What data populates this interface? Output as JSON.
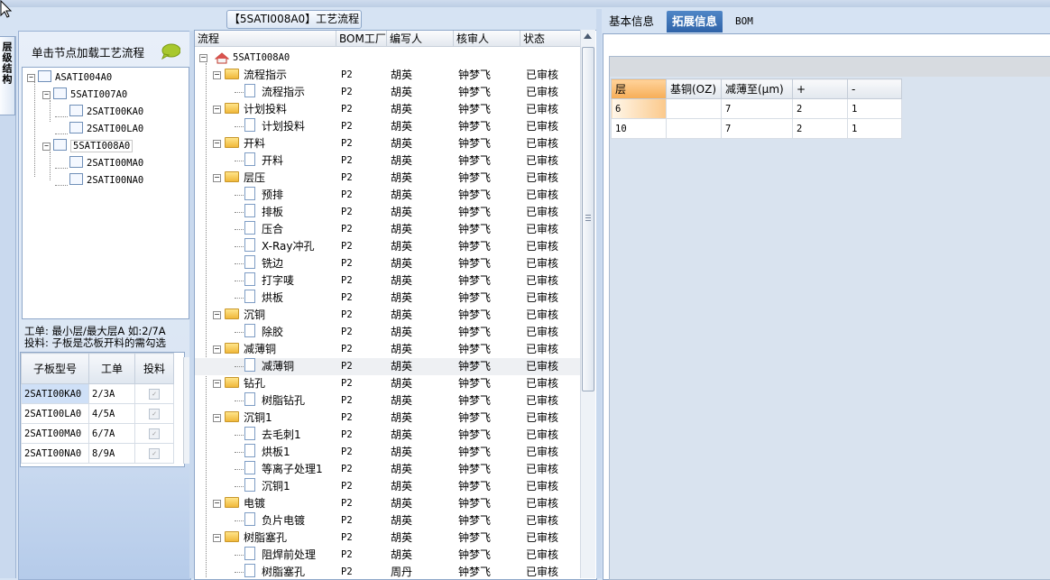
{
  "process_panel": {
    "title": "【5SATI008A0】工艺流程",
    "columns": [
      "流程",
      "BOM工厂",
      "编写人",
      "核审人",
      "状态"
    ],
    "root": "5SATI008A0",
    "rows": [
      {
        "name": "流程指示",
        "type": "folder",
        "factory": "P2",
        "writer": "胡英",
        "reviewer": "钟梦飞",
        "status": "已审核"
      },
      {
        "name": "流程指示",
        "type": "doc",
        "factory": "P2",
        "writer": "胡英",
        "reviewer": "钟梦飞",
        "status": "已审核"
      },
      {
        "name": "计划投料",
        "type": "folder",
        "factory": "P2",
        "writer": "胡英",
        "reviewer": "钟梦飞",
        "status": "已审核"
      },
      {
        "name": "计划投料",
        "type": "doc",
        "factory": "P2",
        "writer": "胡英",
        "reviewer": "钟梦飞",
        "status": "已审核"
      },
      {
        "name": "开料",
        "type": "folder",
        "factory": "P2",
        "writer": "胡英",
        "reviewer": "钟梦飞",
        "status": "已审核"
      },
      {
        "name": "开料",
        "type": "doc",
        "factory": "P2",
        "writer": "胡英",
        "reviewer": "钟梦飞",
        "status": "已审核"
      },
      {
        "name": "层压",
        "type": "folder",
        "factory": "P2",
        "writer": "胡英",
        "reviewer": "钟梦飞",
        "status": "已审核"
      },
      {
        "name": "预排",
        "type": "doc",
        "factory": "P2",
        "writer": "胡英",
        "reviewer": "钟梦飞",
        "status": "已审核"
      },
      {
        "name": "排板",
        "type": "doc",
        "factory": "P2",
        "writer": "胡英",
        "reviewer": "钟梦飞",
        "status": "已审核"
      },
      {
        "name": "压合",
        "type": "doc",
        "factory": "P2",
        "writer": "胡英",
        "reviewer": "钟梦飞",
        "status": "已审核"
      },
      {
        "name": "X-Ray冲孔",
        "type": "doc",
        "factory": "P2",
        "writer": "胡英",
        "reviewer": "钟梦飞",
        "status": "已审核"
      },
      {
        "name": "铣边",
        "type": "doc",
        "factory": "P2",
        "writer": "胡英",
        "reviewer": "钟梦飞",
        "status": "已审核"
      },
      {
        "name": "打字唛",
        "type": "doc",
        "factory": "P2",
        "writer": "胡英",
        "reviewer": "钟梦飞",
        "status": "已审核"
      },
      {
        "name": "烘板",
        "type": "doc",
        "factory": "P2",
        "writer": "胡英",
        "reviewer": "钟梦飞",
        "status": "已审核"
      },
      {
        "name": "沉铜",
        "type": "folder",
        "factory": "P2",
        "writer": "胡英",
        "reviewer": "钟梦飞",
        "status": "已审核"
      },
      {
        "name": "除胶",
        "type": "doc",
        "factory": "P2",
        "writer": "胡英",
        "reviewer": "钟梦飞",
        "status": "已审核"
      },
      {
        "name": "减薄铜",
        "type": "folder",
        "factory": "P2",
        "writer": "胡英",
        "reviewer": "钟梦飞",
        "status": "已审核"
      },
      {
        "name": "减薄铜",
        "type": "doc",
        "factory": "P2",
        "writer": "胡英",
        "reviewer": "钟梦飞",
        "status": "已审核",
        "selected": true
      },
      {
        "name": "钻孔",
        "type": "folder",
        "factory": "P2",
        "writer": "胡英",
        "reviewer": "钟梦飞",
        "status": "已审核"
      },
      {
        "name": "树脂钻孔",
        "type": "doc",
        "factory": "P2",
        "writer": "胡英",
        "reviewer": "钟梦飞",
        "status": "已审核"
      },
      {
        "name": "沉铜1",
        "type": "folder",
        "factory": "P2",
        "writer": "胡英",
        "reviewer": "钟梦飞",
        "status": "已审核"
      },
      {
        "name": "去毛刺1",
        "type": "doc",
        "factory": "P2",
        "writer": "胡英",
        "reviewer": "钟梦飞",
        "status": "已审核"
      },
      {
        "name": "烘板1",
        "type": "doc",
        "factory": "P2",
        "writer": "胡英",
        "reviewer": "钟梦飞",
        "status": "已审核"
      },
      {
        "name": "等离子处理1",
        "type": "doc",
        "factory": "P2",
        "writer": "胡英",
        "reviewer": "钟梦飞",
        "status": "已审核"
      },
      {
        "name": "沉铜1",
        "type": "doc",
        "factory": "P2",
        "writer": "胡英",
        "reviewer": "钟梦飞",
        "status": "已审核"
      },
      {
        "name": "电镀",
        "type": "folder",
        "factory": "P2",
        "writer": "胡英",
        "reviewer": "钟梦飞",
        "status": "已审核"
      },
      {
        "name": "负片电镀",
        "type": "doc",
        "factory": "P2",
        "writer": "胡英",
        "reviewer": "钟梦飞",
        "status": "已审核"
      },
      {
        "name": "树脂塞孔",
        "type": "folder",
        "factory": "P2",
        "writer": "胡英",
        "reviewer": "钟梦飞",
        "status": "已审核"
      },
      {
        "name": "阻焊前处理",
        "type": "doc",
        "factory": "P2",
        "writer": "胡英",
        "reviewer": "钟梦飞",
        "status": "已审核"
      },
      {
        "name": "树脂塞孔",
        "type": "doc",
        "factory": "P2",
        "writer": "周丹",
        "reviewer": "钟梦飞",
        "status": "已审核"
      }
    ]
  },
  "left_panel": {
    "vertical_tab": "层级结构",
    "hint": "单击节点加载工艺流程",
    "tree": [
      {
        "label": "ASATI004A0"
      },
      {
        "label": "5SATI007A0"
      },
      {
        "label": "2SATI00KA0"
      },
      {
        "label": "2SATI00LA0"
      },
      {
        "label": "5SATI008A0"
      },
      {
        "label": "2SATI00MA0"
      },
      {
        "label": "2SATI00NA0"
      }
    ],
    "info_line1": "工单: 最小层/最大层A 如:2/7A",
    "info_line2": "投料: 子板是芯板开料的需勾选",
    "sub_columns": [
      "子板型号",
      "工单",
      "投料"
    ],
    "sub_rows": [
      {
        "model": "2SATI00KA0",
        "order": "2/3A",
        "feed": "✓"
      },
      {
        "model": "2SATI00LA0",
        "order": "4/5A",
        "feed": "✓"
      },
      {
        "model": "2SATI00MA0",
        "order": "6/7A",
        "feed": "✓"
      },
      {
        "model": "2SATI00NA0",
        "order": "8/9A",
        "feed": "✓"
      }
    ]
  },
  "right_panel": {
    "tabs": [
      "基本信息",
      "拓展信息",
      "BOM"
    ],
    "active_tab": "拓展信息",
    "grid_columns": [
      "层",
      "基铜(OZ)",
      "减薄至(μm)",
      "+",
      "-"
    ],
    "grid_rows": [
      {
        "layer": "6",
        "base": "",
        "thin": "7",
        "plus": "2",
        "minus": "1"
      },
      {
        "layer": "10",
        "base": "",
        "thin": "7",
        "plus": "2",
        "minus": "1"
      }
    ]
  }
}
